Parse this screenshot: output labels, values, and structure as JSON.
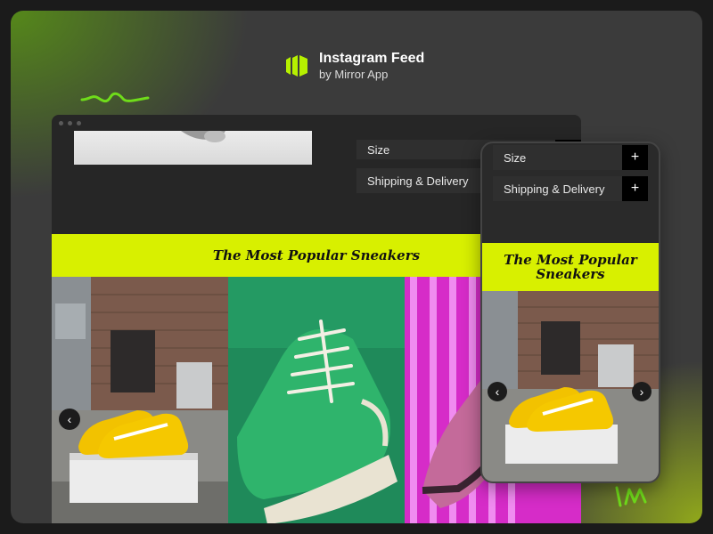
{
  "brand": {
    "title": "Instagram Feed",
    "subtitle": "by Mirror App",
    "accent": "#b6f000"
  },
  "desktop": {
    "accordion": [
      {
        "label": "Size",
        "icon": "plus-icon"
      },
      {
        "label": "Shipping & Delivery",
        "icon": "plus-icon"
      }
    ],
    "banner_title": "The Most Popular Sneakers",
    "prev_icon": "chevron-left-icon",
    "feed": [
      {
        "name": "yellow-sneakers-photo"
      },
      {
        "name": "green-sneakers-photo"
      },
      {
        "name": "pink-sneaker-photo"
      }
    ]
  },
  "mobile": {
    "accordion": [
      {
        "label": "Size",
        "icon": "plus-icon"
      },
      {
        "label": "Shipping & Delivery",
        "icon": "plus-icon"
      }
    ],
    "banner_title": "The Most Popular Sneakers",
    "prev_icon": "chevron-left-icon",
    "next_icon": "chevron-right-icon"
  },
  "colors": {
    "banner": "#d8f000",
    "panel": "#262626",
    "row": "#2f2f2f"
  }
}
